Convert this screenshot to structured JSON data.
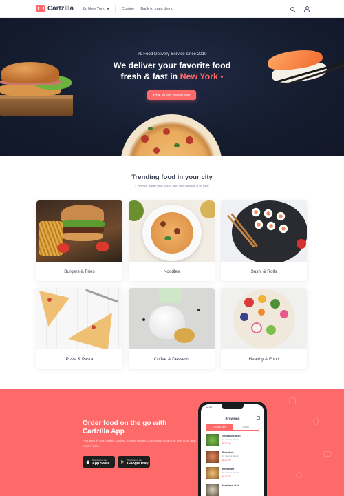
{
  "header": {
    "logo_text": "Cartzilla",
    "location": "New York",
    "nav": [
      "Cuisine",
      "Back to main demo"
    ]
  },
  "hero": {
    "kicker": "#1 Food Delivery Service since 2010",
    "title_line1": "We deliver your favorite food",
    "title_line2_prefix": "fresh & fast in ",
    "title_city": "New York",
    "title_suffix": " -",
    "cta": "What do you want to eat?"
  },
  "trending": {
    "title": "Trending food in your city",
    "subtitle": "Choose what you want and we deliver it to you",
    "categories": [
      "Burgers & Fries",
      "Noodles",
      "Sushi & Rolls",
      "Pizza & Pasta",
      "Coffee & Desserts",
      "Healthy & Food"
    ]
  },
  "app_promo": {
    "title_line1": "Order food on the go with",
    "title_line2": "Cartzilla App",
    "description": "Pay with in-app wallet, collect loyalty points, track your orders in real time and much more.",
    "app_store": {
      "small": "Download on the",
      "large": "App Store"
    },
    "google_play": {
      "small": "Download on the",
      "large": "Google Play"
    },
    "phone": {
      "time": "12:30",
      "title": "Browsing",
      "tabs": [
        "Choose dish",
        "Orders"
      ],
      "items": [
        {
          "name": "Vegetable dish",
          "meta": "15 minutes delivery",
          "price": "$ 25.30"
        },
        {
          "name": "Fish dish",
          "meta": "15 minutes delivery",
          "price": "$ 20.20"
        },
        {
          "name": "Breakfast",
          "meta": "15 minutes delivery",
          "price": "$ 13.25"
        },
        {
          "name": "Meatless dish",
          "meta": "",
          "price": ""
        }
      ]
    }
  },
  "colors": {
    "accent": "#fe696a",
    "hero_bg": "#151c2f",
    "text_dark": "#373f50",
    "text_muted": "#7d879c"
  },
  "icons": [
    "location-pin-icon",
    "caret-down-icon",
    "search-icon",
    "user-icon",
    "apple-icon",
    "google-play-icon",
    "filter-icon"
  ]
}
